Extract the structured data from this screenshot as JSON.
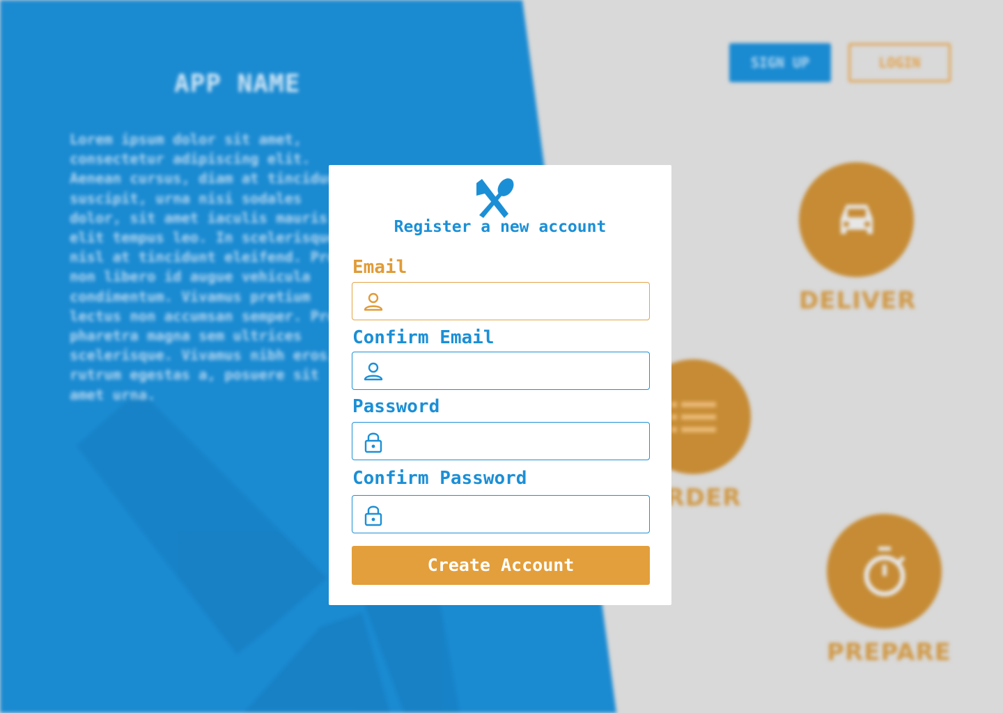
{
  "background": {
    "app_name": "APP NAME",
    "description": "Lorem ipsum dolor sit amet, consectetur adipiscing elit. Aenean cursus, diam at tincidunt suscipit, urna nisi sodales dolor, sit amet iaculis mauris elit tempus leo. In scelerisque nisl at tincidunt eleifend. Proin non libero id augue vehicula condimentum. Vivamus pretium lectus non accumsan semper. Proin pharetra magna sem ultrices scelerisque. Vivamus nibh eros, rutrum egestas a, posuere sit amet urna.",
    "header": {
      "signup_label": "SIGN UP",
      "login_label": "LOGIN"
    },
    "features": [
      {
        "label": "DELIVER",
        "icon": "car-icon"
      },
      {
        "label": "ORDER",
        "icon": "list-icon"
      },
      {
        "label": "PREPARE",
        "icon": "stopwatch-icon"
      }
    ],
    "colors": {
      "blue": "#1a8ad1",
      "gray": "#d9d9d9",
      "orange": "#c68b34"
    }
  },
  "modal": {
    "logo_icon": "fork-spoon-icon",
    "title": "Register a new account",
    "fields": [
      {
        "label": "Email",
        "icon": "user-icon",
        "value": "",
        "placeholder": ""
      },
      {
        "label": "Confirm Email",
        "icon": "user-icon",
        "value": "",
        "placeholder": ""
      },
      {
        "label": "Password",
        "icon": "lock-icon",
        "value": "",
        "placeholder": ""
      },
      {
        "label": "Confirm Password",
        "icon": "lock-icon",
        "value": "",
        "placeholder": ""
      }
    ],
    "submit_label": "Create Account",
    "colors": {
      "primary": "#1b8fd6",
      "accent": "#e39f3b"
    }
  }
}
